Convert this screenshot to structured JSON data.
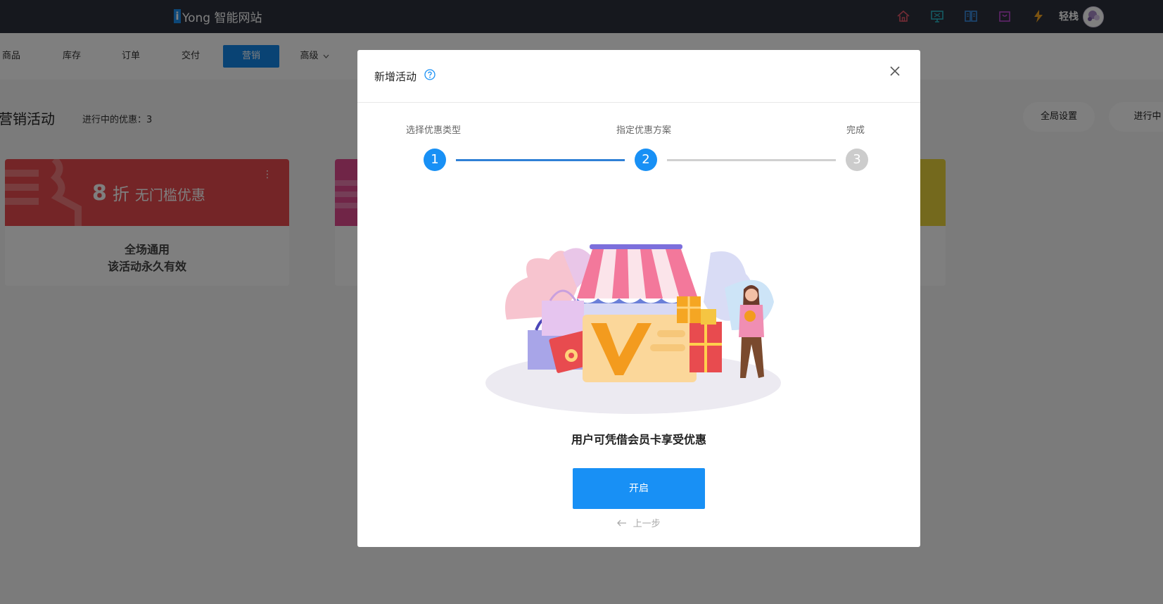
{
  "app": {
    "logo_i": "i",
    "logo_text": "Yong 智能网站"
  },
  "topbar": {
    "icons": [
      "home-icon",
      "monitor-icon",
      "book-icon",
      "shopping-bag-icon",
      "lightning-icon"
    ],
    "user_name": "轻栈"
  },
  "nav": {
    "items": [
      {
        "label": "商品"
      },
      {
        "label": "库存"
      },
      {
        "label": "订单"
      },
      {
        "label": "交付"
      },
      {
        "label": "营销"
      },
      {
        "label": "高级"
      }
    ],
    "active_index": 4,
    "dropdown_icon": "chevron-down-icon"
  },
  "page": {
    "title": "营销活动",
    "promo_count_text": "进行中的优惠：3",
    "global_settings_label": "全局设置",
    "in_progress_label": "进行中"
  },
  "cards": [
    {
      "discount_number": "8",
      "discount_unit": "折",
      "discount_desc": "无门槛优惠",
      "scope": "全场通用",
      "validity": "该活动永久有效",
      "color": "#e84b4f"
    },
    {
      "color": "#e04a8f"
    },
    {
      "color": "#e8d23a"
    }
  ],
  "modal": {
    "title": "新增活动",
    "close_icon": "close-icon",
    "help_icon": "question-circle-icon",
    "steps": [
      {
        "label": "选择优惠类型",
        "number": "1"
      },
      {
        "label": "指定优惠方案",
        "number": "2"
      },
      {
        "label": "完成",
        "number": "3"
      }
    ],
    "current_step": 2,
    "message": "用户可凭借会员卡享受优惠",
    "open_button": "开启",
    "prev_button": "上一步"
  },
  "colors": {
    "topbar_bg": "#2c313d",
    "accent": "#1890f5",
    "step_done": "#1890f5",
    "step_pending": "#cccccc"
  }
}
